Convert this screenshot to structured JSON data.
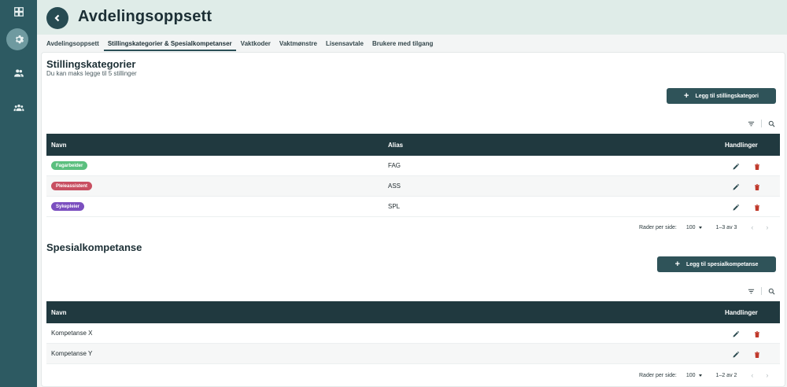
{
  "page": {
    "title": "Avdelingsoppsett"
  },
  "rail": {
    "icons": [
      "dashboard-icon",
      "settings-icon",
      "person-icon",
      "group-icon"
    ]
  },
  "tabs": [
    {
      "label": "Avdelingsoppsett"
    },
    {
      "label": "Stillingskategorier & Spesialkompetanser",
      "active": true
    },
    {
      "label": "Vaktkoder"
    },
    {
      "label": "Vaktmønstre"
    },
    {
      "label": "Lisensavtale"
    },
    {
      "label": "Brukere med tilgang"
    }
  ],
  "stillingskategorier": {
    "title": "Stillingskategorier",
    "subtitle": "Du kan maks legge til 5 stillinger",
    "add_label": "Legg til stillingskategori",
    "columns": {
      "name": "Navn",
      "alias": "Alias",
      "actions": "Handlinger"
    },
    "rows": [
      {
        "name": "Fagarbeider",
        "alias": "FAG",
        "color": "#5bbf7e"
      },
      {
        "name": "Pleieassistent",
        "alias": "ASS",
        "color": "#c84f61"
      },
      {
        "name": "Sykepleier",
        "alias": "SPL",
        "color": "#7b4fbf"
      }
    ],
    "pagination": {
      "rows_label": "Rader per side:",
      "rows_value": "100",
      "range": "1–3 av 3"
    }
  },
  "spesialkompetanse": {
    "title": "Spesialkompetanse",
    "add_label": "Legg til spesialkompetanse",
    "columns": {
      "name": "Navn",
      "actions": "Handlinger"
    },
    "rows": [
      {
        "name": "Kompetanse X"
      },
      {
        "name": "Kompetanse Y"
      }
    ],
    "pagination": {
      "rows_label": "Rader per side:",
      "rows_value": "100",
      "range": "1–2 av 2"
    }
  },
  "colors": {
    "rail": "#2d5a62",
    "header": "#dfece8",
    "table_head": "#20393f",
    "button": "#2f5359",
    "edit": "#2b4a4f",
    "delete": "#c0392b"
  }
}
